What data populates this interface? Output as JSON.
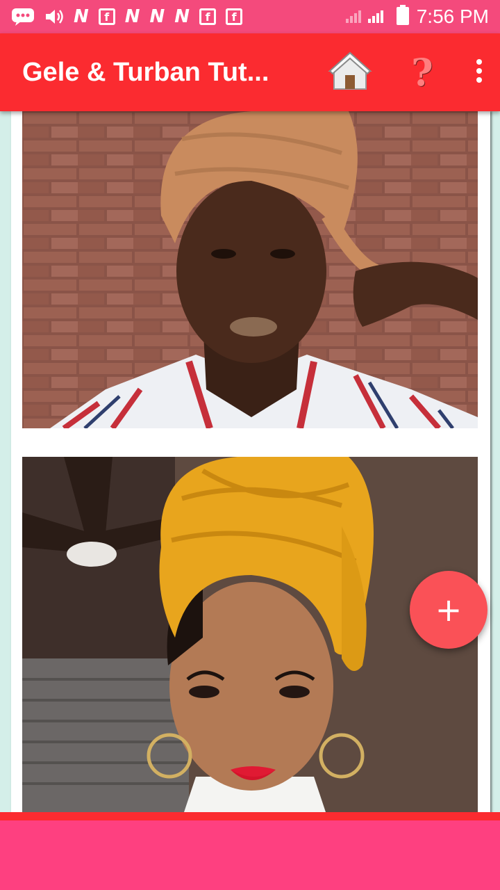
{
  "status_bar": {
    "time": "7:56 PM",
    "notifications": [
      "message-icon",
      "volume-icon",
      "n-app-icon",
      "flipboard-icon",
      "n-app-icon",
      "n-app-icon",
      "n-app-icon",
      "flipboard-icon",
      "flipboard-icon"
    ],
    "battery": "battery-icon",
    "signal": "signal-icon"
  },
  "app_bar": {
    "title": "Gele & Turban Tut...",
    "home_icon": "home-icon",
    "help_label": "?",
    "menu_icon": "more-vert-icon"
  },
  "gallery": {
    "items": [
      {
        "alt": "woman wearing tan turban"
      },
      {
        "alt": "woman wearing mustard yellow turban"
      }
    ]
  },
  "fab": {
    "label": "+"
  },
  "colors": {
    "status_bar": "#f44a7c",
    "app_bar": "#fb2b30",
    "fab": "#fa5157",
    "bottom_bar": "#fe4080",
    "background": "#d4efe9"
  }
}
